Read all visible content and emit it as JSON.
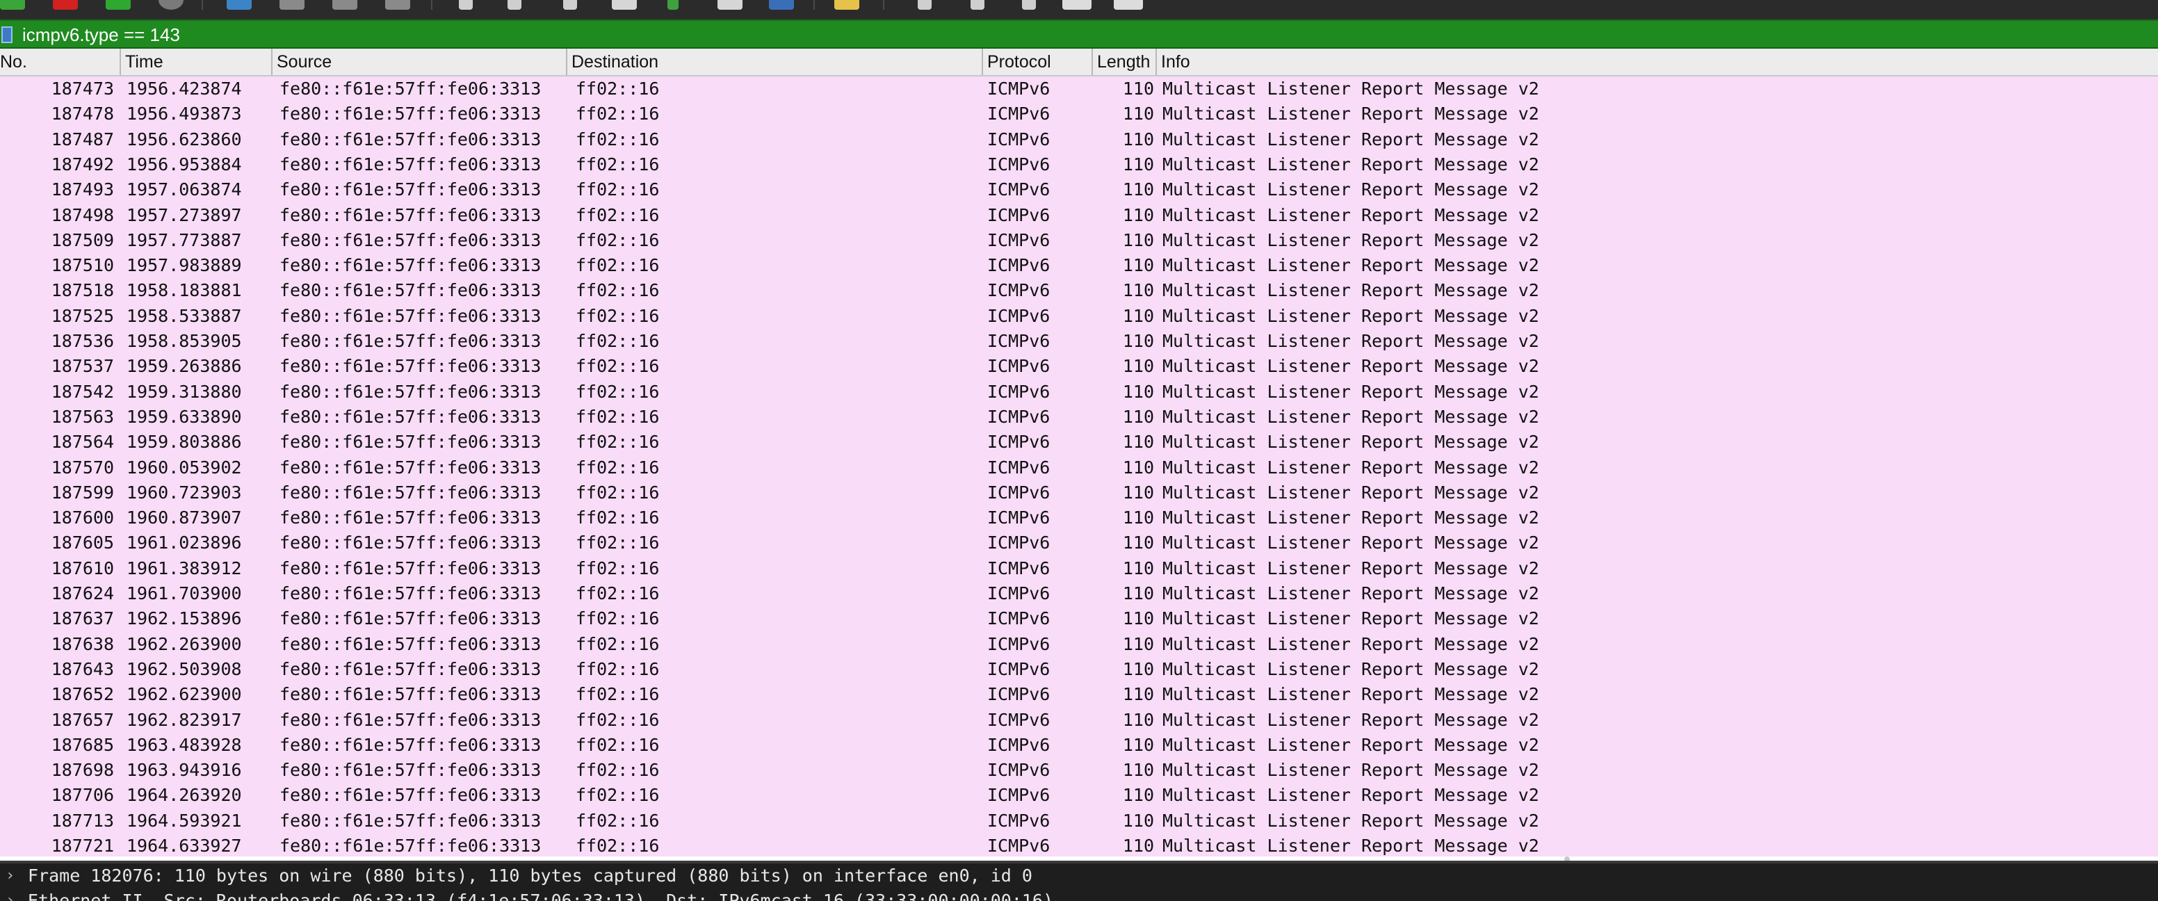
{
  "filter": {
    "text": "icmpv6.type == 143"
  },
  "columns": [
    "No.",
    "Time",
    "Source",
    "Destination",
    "Protocol",
    "Length",
    "Info"
  ],
  "packets": [
    {
      "no": "187473",
      "time": "1956.423874",
      "src": "fe80::f61e:57ff:fe06:3313",
      "dst": "ff02::16",
      "proto": "ICMPv6",
      "len": "110",
      "info": "Multicast Listener Report Message v2"
    },
    {
      "no": "187478",
      "time": "1956.493873",
      "src": "fe80::f61e:57ff:fe06:3313",
      "dst": "ff02::16",
      "proto": "ICMPv6",
      "len": "110",
      "info": "Multicast Listener Report Message v2"
    },
    {
      "no": "187487",
      "time": "1956.623860",
      "src": "fe80::f61e:57ff:fe06:3313",
      "dst": "ff02::16",
      "proto": "ICMPv6",
      "len": "110",
      "info": "Multicast Listener Report Message v2"
    },
    {
      "no": "187492",
      "time": "1956.953884",
      "src": "fe80::f61e:57ff:fe06:3313",
      "dst": "ff02::16",
      "proto": "ICMPv6",
      "len": "110",
      "info": "Multicast Listener Report Message v2"
    },
    {
      "no": "187493",
      "time": "1957.063874",
      "src": "fe80::f61e:57ff:fe06:3313",
      "dst": "ff02::16",
      "proto": "ICMPv6",
      "len": "110",
      "info": "Multicast Listener Report Message v2"
    },
    {
      "no": "187498",
      "time": "1957.273897",
      "src": "fe80::f61e:57ff:fe06:3313",
      "dst": "ff02::16",
      "proto": "ICMPv6",
      "len": "110",
      "info": "Multicast Listener Report Message v2"
    },
    {
      "no": "187509",
      "time": "1957.773887",
      "src": "fe80::f61e:57ff:fe06:3313",
      "dst": "ff02::16",
      "proto": "ICMPv6",
      "len": "110",
      "info": "Multicast Listener Report Message v2"
    },
    {
      "no": "187510",
      "time": "1957.983889",
      "src": "fe80::f61e:57ff:fe06:3313",
      "dst": "ff02::16",
      "proto": "ICMPv6",
      "len": "110",
      "info": "Multicast Listener Report Message v2"
    },
    {
      "no": "187518",
      "time": "1958.183881",
      "src": "fe80::f61e:57ff:fe06:3313",
      "dst": "ff02::16",
      "proto": "ICMPv6",
      "len": "110",
      "info": "Multicast Listener Report Message v2"
    },
    {
      "no": "187525",
      "time": "1958.533887",
      "src": "fe80::f61e:57ff:fe06:3313",
      "dst": "ff02::16",
      "proto": "ICMPv6",
      "len": "110",
      "info": "Multicast Listener Report Message v2"
    },
    {
      "no": "187536",
      "time": "1958.853905",
      "src": "fe80::f61e:57ff:fe06:3313",
      "dst": "ff02::16",
      "proto": "ICMPv6",
      "len": "110",
      "info": "Multicast Listener Report Message v2"
    },
    {
      "no": "187537",
      "time": "1959.263886",
      "src": "fe80::f61e:57ff:fe06:3313",
      "dst": "ff02::16",
      "proto": "ICMPv6",
      "len": "110",
      "info": "Multicast Listener Report Message v2"
    },
    {
      "no": "187542",
      "time": "1959.313880",
      "src": "fe80::f61e:57ff:fe06:3313",
      "dst": "ff02::16",
      "proto": "ICMPv6",
      "len": "110",
      "info": "Multicast Listener Report Message v2"
    },
    {
      "no": "187563",
      "time": "1959.633890",
      "src": "fe80::f61e:57ff:fe06:3313",
      "dst": "ff02::16",
      "proto": "ICMPv6",
      "len": "110",
      "info": "Multicast Listener Report Message v2"
    },
    {
      "no": "187564",
      "time": "1959.803886",
      "src": "fe80::f61e:57ff:fe06:3313",
      "dst": "ff02::16",
      "proto": "ICMPv6",
      "len": "110",
      "info": "Multicast Listener Report Message v2"
    },
    {
      "no": "187570",
      "time": "1960.053902",
      "src": "fe80::f61e:57ff:fe06:3313",
      "dst": "ff02::16",
      "proto": "ICMPv6",
      "len": "110",
      "info": "Multicast Listener Report Message v2"
    },
    {
      "no": "187599",
      "time": "1960.723903",
      "src": "fe80::f61e:57ff:fe06:3313",
      "dst": "ff02::16",
      "proto": "ICMPv6",
      "len": "110",
      "info": "Multicast Listener Report Message v2"
    },
    {
      "no": "187600",
      "time": "1960.873907",
      "src": "fe80::f61e:57ff:fe06:3313",
      "dst": "ff02::16",
      "proto": "ICMPv6",
      "len": "110",
      "info": "Multicast Listener Report Message v2"
    },
    {
      "no": "187605",
      "time": "1961.023896",
      "src": "fe80::f61e:57ff:fe06:3313",
      "dst": "ff02::16",
      "proto": "ICMPv6",
      "len": "110",
      "info": "Multicast Listener Report Message v2"
    },
    {
      "no": "187610",
      "time": "1961.383912",
      "src": "fe80::f61e:57ff:fe06:3313",
      "dst": "ff02::16",
      "proto": "ICMPv6",
      "len": "110",
      "info": "Multicast Listener Report Message v2"
    },
    {
      "no": "187624",
      "time": "1961.703900",
      "src": "fe80::f61e:57ff:fe06:3313",
      "dst": "ff02::16",
      "proto": "ICMPv6",
      "len": "110",
      "info": "Multicast Listener Report Message v2"
    },
    {
      "no": "187637",
      "time": "1962.153896",
      "src": "fe80::f61e:57ff:fe06:3313",
      "dst": "ff02::16",
      "proto": "ICMPv6",
      "len": "110",
      "info": "Multicast Listener Report Message v2"
    },
    {
      "no": "187638",
      "time": "1962.263900",
      "src": "fe80::f61e:57ff:fe06:3313",
      "dst": "ff02::16",
      "proto": "ICMPv6",
      "len": "110",
      "info": "Multicast Listener Report Message v2"
    },
    {
      "no": "187643",
      "time": "1962.503908",
      "src": "fe80::f61e:57ff:fe06:3313",
      "dst": "ff02::16",
      "proto": "ICMPv6",
      "len": "110",
      "info": "Multicast Listener Report Message v2"
    },
    {
      "no": "187652",
      "time": "1962.623900",
      "src": "fe80::f61e:57ff:fe06:3313",
      "dst": "ff02::16",
      "proto": "ICMPv6",
      "len": "110",
      "info": "Multicast Listener Report Message v2"
    },
    {
      "no": "187657",
      "time": "1962.823917",
      "src": "fe80::f61e:57ff:fe06:3313",
      "dst": "ff02::16",
      "proto": "ICMPv6",
      "len": "110",
      "info": "Multicast Listener Report Message v2"
    },
    {
      "no": "187685",
      "time": "1963.483928",
      "src": "fe80::f61e:57ff:fe06:3313",
      "dst": "ff02::16",
      "proto": "ICMPv6",
      "len": "110",
      "info": "Multicast Listener Report Message v2"
    },
    {
      "no": "187698",
      "time": "1963.943916",
      "src": "fe80::f61e:57ff:fe06:3313",
      "dst": "ff02::16",
      "proto": "ICMPv6",
      "len": "110",
      "info": "Multicast Listener Report Message v2"
    },
    {
      "no": "187706",
      "time": "1964.263920",
      "src": "fe80::f61e:57ff:fe06:3313",
      "dst": "ff02::16",
      "proto": "ICMPv6",
      "len": "110",
      "info": "Multicast Listener Report Message v2"
    },
    {
      "no": "187713",
      "time": "1964.593921",
      "src": "fe80::f61e:57ff:fe06:3313",
      "dst": "ff02::16",
      "proto": "ICMPv6",
      "len": "110",
      "info": "Multicast Listener Report Message v2"
    },
    {
      "no": "187721",
      "time": "1964.633927",
      "src": "fe80::f61e:57ff:fe06:3313",
      "dst": "ff02::16",
      "proto": "ICMPv6",
      "len": "110",
      "info": "Multicast Listener Report Message v2"
    }
  ],
  "details": [
    {
      "text": "Frame 182076: 110 bytes on wire (880 bits), 110 bytes captured (880 bits) on interface en0, id 0"
    },
    {
      "text": "Ethernet II, Src: Routerboards 06:33:13 (f4:1e:57:06:33:13), Dst: IPv6mcast 16 (33:33:00:00:00:16)"
    }
  ],
  "colors": {
    "row_bg": "#f8dcf8",
    "filter_bg": "#1f8a1f",
    "header_bg": "#ececec",
    "detail_bg": "#1e1e1e"
  }
}
